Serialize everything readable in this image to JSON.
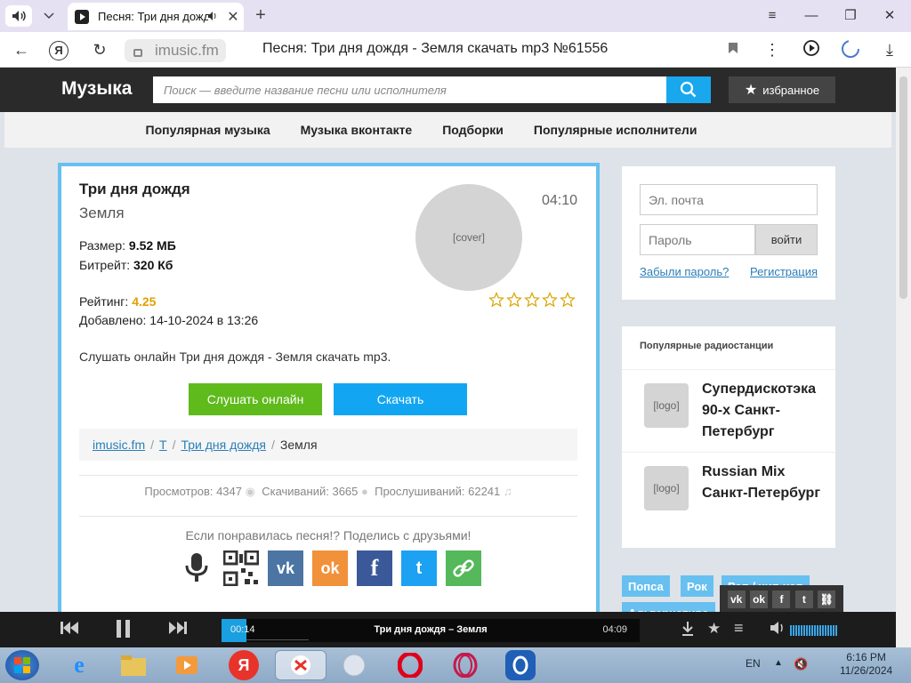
{
  "browser": {
    "tab_title": "Песня: Три дня дождя",
    "url_host": "imusic.fm",
    "page_title": "Песня: Три дня дождя - Земля скачать mp3 №61556",
    "yandex_glyph": "Я"
  },
  "site": {
    "logo": "Музыка",
    "search_placeholder": "Поиск — введите название песни или исполнителя",
    "favorites_label": "избранное",
    "nav": [
      "Популярная музыка",
      "Музыка вконтакте",
      "Подборки",
      "Популярные исполнители"
    ]
  },
  "song": {
    "title": "Три дня дождя",
    "artist": "Земля",
    "duration": "04:10",
    "size_label": "Размер:",
    "size_value": "9.52 МБ",
    "bitrate_label": "Битрейт:",
    "bitrate_value": "320 Кб",
    "rating_label": "Рейтинг:",
    "rating_value": "4.25",
    "added": "Добавлено: 14-10-2024 в 13:26",
    "description": "Слушать онлайн Три дня дождя - Земля скачать mp3.",
    "listen_button": "Слушать онлайн",
    "download_button": "Скачать",
    "stars_count": 5
  },
  "breadcrumbs": [
    {
      "label": "imusic.fm",
      "link": true
    },
    {
      "label": "Т",
      "link": true
    },
    {
      "label": "Три дня дождя",
      "link": true
    },
    {
      "label": "Земля",
      "link": false
    }
  ],
  "breadcrumb_separator": "/",
  "stats": {
    "views": "Просмотров: 4347",
    "downloads": "Скачиваний: 3665",
    "listens": "Прослушиваний: 62241"
  },
  "share": {
    "text": "Если понравилась песня!? Поделись с друзьями!",
    "icons": [
      "microphone-icon",
      "qr-code-icon",
      "vk-icon",
      "odnoklassniki-icon",
      "facebook-icon",
      "twitter-icon",
      "link-icon"
    ],
    "vk_glyph": "vk",
    "ok_glyph": "ok",
    "fb_glyph": "f",
    "tw_glyph": "t"
  },
  "login": {
    "email_placeholder": "Эл. почта",
    "password_placeholder": "Пароль",
    "submit": "войти",
    "forgot": "Забыли пароль?",
    "register": "Регистрация"
  },
  "radio": {
    "header": "Популярные радиостанции",
    "stations": [
      {
        "name": "Супердискотэка 90-х Санкт-Петербург"
      },
      {
        "name": "Russian Mix Санкт-Петербург"
      }
    ]
  },
  "tags": [
    "Попса",
    "Рок",
    "Рэп / хип-хоп",
    "Альтернатива"
  ],
  "player": {
    "current_time": "00:14",
    "track": "Три дня дождя – Земля",
    "total_time": "04:09",
    "progress": 0.056
  },
  "taskbar": {
    "language": "EN",
    "time": "6:16 PM",
    "date": "11/26/2024"
  },
  "colors": {
    "accent_blue": "#19a8ee",
    "listen_green": "#5fba1c",
    "download_blue": "#12a6f2",
    "card_border": "#67c0f0",
    "rating_gold": "#e2a000"
  }
}
